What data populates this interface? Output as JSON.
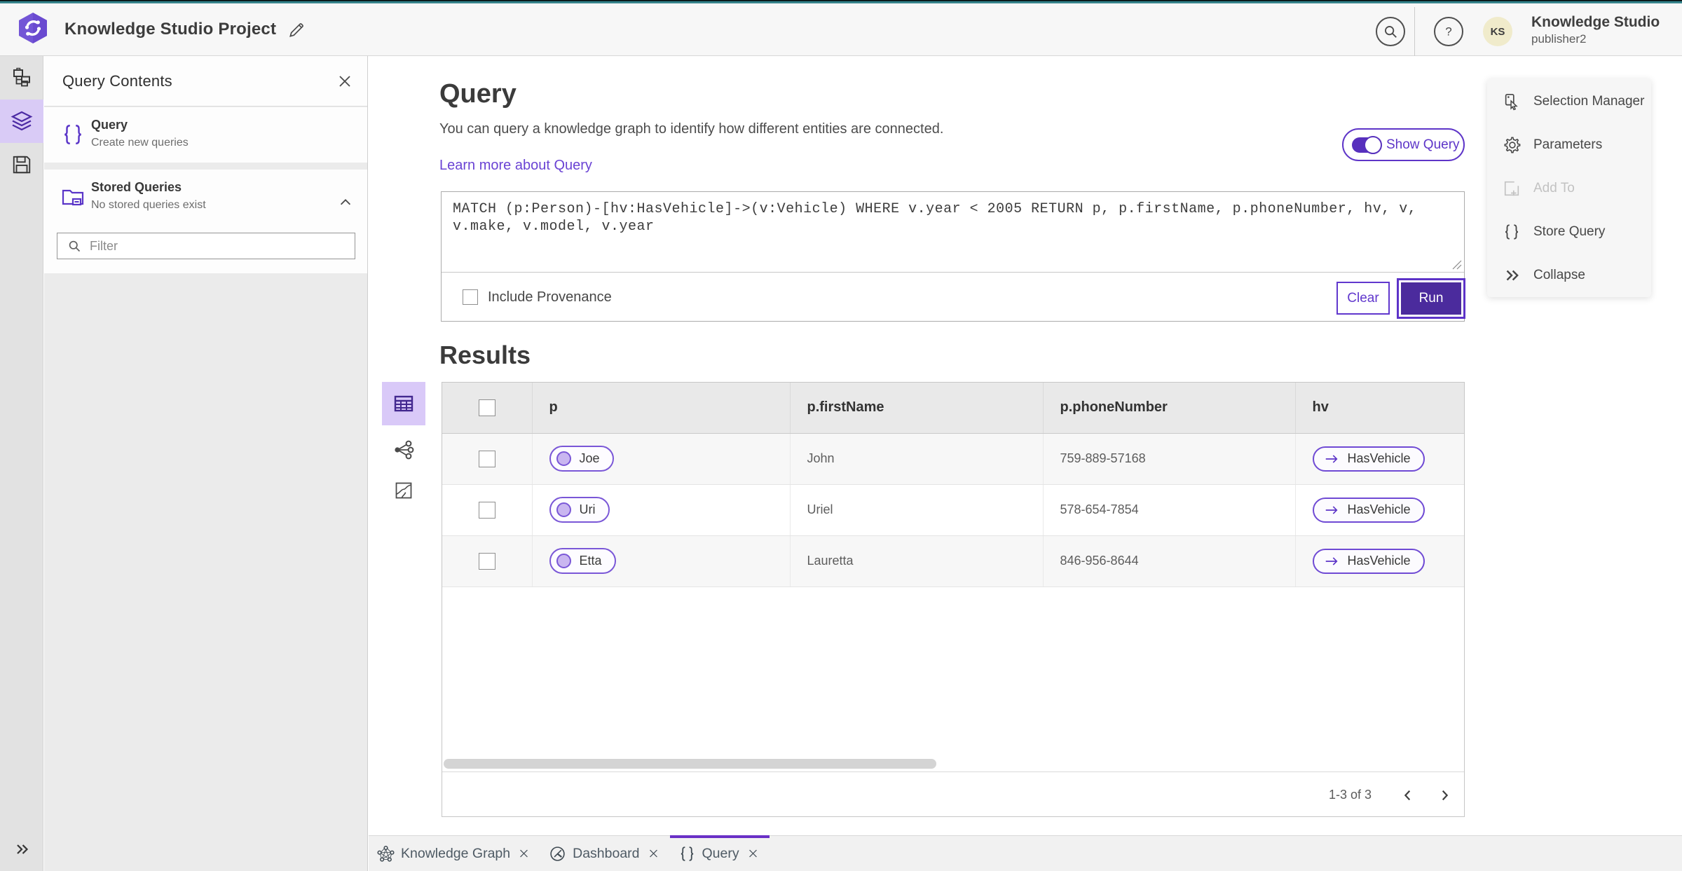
{
  "app": {
    "title": "Knowledge Studio Project",
    "user_name": "Knowledge Studio",
    "user_role": "publisher2",
    "avatar_initials": "KS"
  },
  "colors": {
    "accent_purple": "#5E35C8",
    "run_fill_purple": "#4B2B9D",
    "teal_strip": "#2E7F87",
    "selected_tile": "#D9C9F8"
  },
  "panel": {
    "title": "Query Contents",
    "query_item": {
      "title": "Query",
      "subtitle": "Create new queries",
      "icon": "braces-icon"
    },
    "stored_item": {
      "title": "Stored Queries",
      "subtitle": "No stored queries exist",
      "icon": "folder-icon"
    },
    "filter_placeholder": "Filter"
  },
  "sidebar": {
    "items": [
      {
        "icon": "data-model-icon",
        "selected": false
      },
      {
        "icon": "layers-icon",
        "selected": true
      },
      {
        "icon": "save-icon",
        "selected": false
      }
    ],
    "expand_icon": "double-chevron-right-icon"
  },
  "query": {
    "heading": "Query",
    "description": "You can query a knowledge graph to identify how different entities are connected.",
    "link_label": "Learn more about Query",
    "toggle_label": "Show Query",
    "toggle_state": "on",
    "query_text": "MATCH (p:Person)-[hv:HasVehicle]->(v:Vehicle) WHERE v.year < 2005 RETURN p, p.firstName, p.phoneNumber, hv, v, v.make, v.model, v.year",
    "provenance_label": "Include Provenance",
    "provenance_checked": false,
    "clear_label": "Clear",
    "run_label": "Run"
  },
  "results": {
    "heading": "Results",
    "view_icons": [
      "table-view-icon",
      "link-chart-view-icon",
      "map-view-icon"
    ],
    "columns": [
      "p",
      "p.firstName",
      "p.phoneNumber",
      "hv"
    ],
    "rows": [
      {
        "p": "Joe",
        "firstName": "John",
        "phoneNumber": "759-889-57168",
        "hv": "HasVehicle"
      },
      {
        "p": "Uri",
        "firstName": "Uriel",
        "phoneNumber": "578-654-7854",
        "hv": "HasVehicle"
      },
      {
        "p": "Etta",
        "firstName": "Lauretta",
        "phoneNumber": "846-956-8644",
        "hv": "HasVehicle"
      }
    ],
    "pagination": {
      "label": "1-3 of 3"
    }
  },
  "right_menu": {
    "items": [
      {
        "label": "Selection Manager",
        "icon": "selection-manager-icon",
        "disabled": false
      },
      {
        "label": "Parameters",
        "icon": "gear-icon",
        "disabled": false
      },
      {
        "label": "Add To",
        "icon": "add-to-icon",
        "disabled": true
      },
      {
        "label": "Store Query",
        "icon": "braces-icon",
        "disabled": false
      },
      {
        "label": "Collapse",
        "icon": "double-chevron-right-icon",
        "disabled": false
      }
    ]
  },
  "tabs": {
    "items": [
      {
        "label": "Knowledge Graph",
        "icon": "knowledge-graph-icon",
        "active": false
      },
      {
        "label": "Dashboard",
        "icon": "dashboard-icon",
        "active": false
      },
      {
        "label": "Query",
        "icon": "braces-icon",
        "active": true
      }
    ]
  }
}
